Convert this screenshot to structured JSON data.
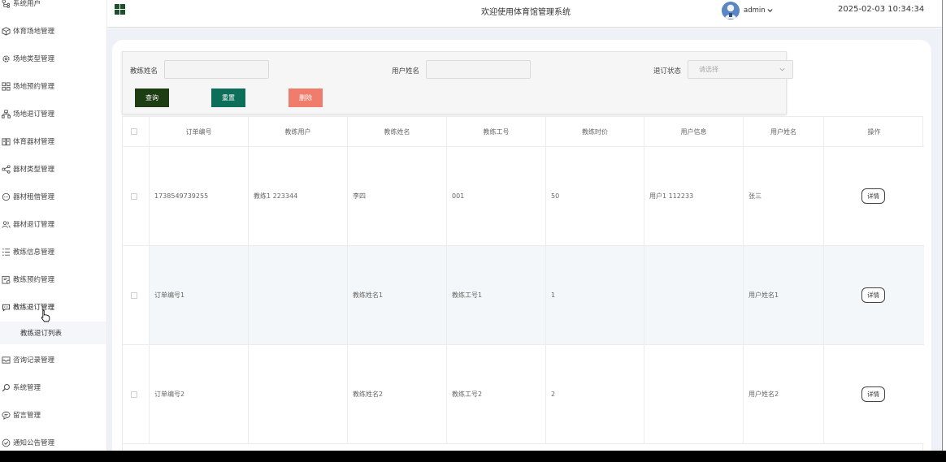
{
  "header": {
    "site_title": "欢迎使用体育馆管理系统",
    "username": "admin",
    "datetime": "2025-02-03 10:34:34"
  },
  "sidebar": {
    "items": [
      {
        "label": "系统用户",
        "icon": "user-tree-icon"
      },
      {
        "label": "体育场地管理",
        "icon": "cube-icon"
      },
      {
        "label": "场地类型管理",
        "icon": "gear-icon"
      },
      {
        "label": "场地预约管理",
        "icon": "grid-icon"
      },
      {
        "label": "场地退订管理",
        "icon": "sitemap-icon"
      },
      {
        "label": "体育器材管理",
        "icon": "book-icon"
      },
      {
        "label": "器材类型管理",
        "icon": "share-icon"
      },
      {
        "label": "器材租借管理",
        "icon": "chat-icon"
      },
      {
        "label": "器材退订管理",
        "icon": "users-icon"
      },
      {
        "label": "教练信息管理",
        "icon": "list-icon"
      },
      {
        "label": "教练预约管理",
        "icon": "calendar-icon"
      },
      {
        "label": "教练退订管理",
        "icon": "message-icon"
      },
      {
        "label": "咨询记录管理",
        "icon": "inbox-icon"
      },
      {
        "label": "系统管理",
        "icon": "search-icon"
      },
      {
        "label": "留言管理",
        "icon": "comment-icon"
      },
      {
        "label": "通知公告管理",
        "icon": "check-circle-icon"
      }
    ],
    "active_sub_item": "教练退订列表"
  },
  "search": {
    "coach_name_label": "教练姓名",
    "user_name_label": "用户姓名",
    "status_label": "退订状态",
    "status_placeholder": "请选择",
    "query_button": "查询",
    "reset_button": "重置",
    "delete_button": "删除"
  },
  "table": {
    "columns": [
      "订单编号",
      "教练用户",
      "教练姓名",
      "教练工号",
      "教练时价",
      "用户信息",
      "用户姓名",
      "操作"
    ],
    "detail_label": "详情",
    "rows": [
      {
        "order_no": "1738549739255",
        "coach_user": "教练1 223344",
        "coach_name": "李四",
        "coach_no": "001",
        "price": "50",
        "user_info": "用户1 112233",
        "user_name": "张三"
      },
      {
        "order_no": "订单编号1",
        "coach_user": "",
        "coach_name": "教练姓名1",
        "coach_no": "教练工号1",
        "price": "1",
        "user_info": "",
        "user_name": "用户姓名1"
      },
      {
        "order_no": "订单编号2",
        "coach_user": "",
        "coach_name": "教练姓名2",
        "coach_no": "教练工号2",
        "price": "2",
        "user_info": "",
        "user_name": "用户姓名2"
      }
    ]
  },
  "colors": {
    "brand_dark_green": "#1d3d13",
    "reset_green": "#0d6f59",
    "delete_coral": "#f07c6c",
    "page_bg": "#eef2f8"
  }
}
